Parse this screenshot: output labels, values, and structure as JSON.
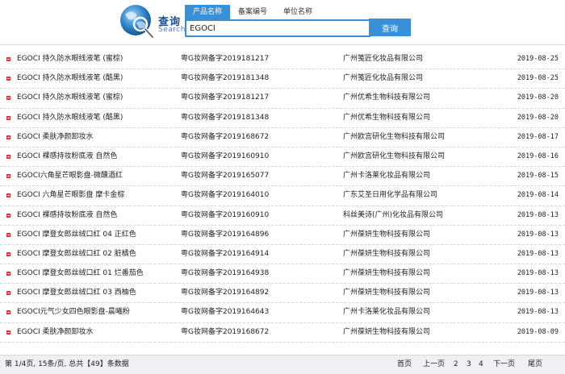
{
  "logo": {
    "title": "查询",
    "subtitle": "Search"
  },
  "tabs": [
    "产品名称",
    "备案编号",
    "单位名称"
  ],
  "search": {
    "value": "EGOCI",
    "button_label": "查询"
  },
  "rows": [
    {
      "name": "EGOCI 持久防水眼线液笔 (蜜棕)",
      "reg": "粤G妆网备字2019181217",
      "company": "广州笺匠化妆品有限公司",
      "date": "2019-08-25"
    },
    {
      "name": "EGOCI 持久防水眼线液笔 (酷黑)",
      "reg": "粤G妆网备字2019181348",
      "company": "广州笺匠化妆品有限公司",
      "date": "2019-08-25"
    },
    {
      "name": "EGOCI 持久防水眼线液笔 (蜜棕)",
      "reg": "粤G妆网备字2019181217",
      "company": "广州优希生物科技有限公司",
      "date": "2019-08-20"
    },
    {
      "name": "EGOCI 持久防水眼线液笔 (酷黑)",
      "reg": "粤G妆网备字2019181348",
      "company": "广州优希生物科技有限公司",
      "date": "2019-08-20"
    },
    {
      "name": "EGOCI 柔肤净颜卸妆水",
      "reg": "粤G妆网备字2019168672",
      "company": "广州欧宫研化生物科技有限公司",
      "date": "2019-08-17"
    },
    {
      "name": "EGOCI 裸感持妆粉底液 自然色",
      "reg": "粤G妆网备字2019160910",
      "company": "广州欧宫研化生物科技有限公司",
      "date": "2019-08-16"
    },
    {
      "name": "EGOCI六角星芒眼影盘-微醺酒红",
      "reg": "粤G妆网备字2019165077",
      "company": "广州卡洛莱化妆品有限公司",
      "date": "2019-08-15"
    },
    {
      "name": "EGOCI 六角星芒眼影盘 摩卡金棕",
      "reg": "粤G妆网备字2019164010",
      "company": "广东艾圣日用化学品有限公司",
      "date": "2019-08-14"
    },
    {
      "name": "EGOCI 裸感持妆粉底液 自然色",
      "reg": "粤G妆网备字2019160910",
      "company": "科丝美诗(广州)化妆品有限公司",
      "date": "2019-08-13"
    },
    {
      "name": "EGOCI 摩登女郎丝绒口红 04 正红色",
      "reg": "粤G妆网备字2019164896",
      "company": "广州葆妍生物科技有限公司",
      "date": "2019-08-13"
    },
    {
      "name": "EGOCI 摩登女郎丝绒口红 02 脏橘色",
      "reg": "粤G妆网备字2019164914",
      "company": "广州葆妍生物科技有限公司",
      "date": "2019-08-13"
    },
    {
      "name": "EGOCI 摩登女郎丝绒口红 01 烂番茄色",
      "reg": "粤G妆网备字2019164938",
      "company": "广州葆妍生物科技有限公司",
      "date": "2019-08-13"
    },
    {
      "name": "EGOCI 摩登女郎丝绒口红 03 西柚色",
      "reg": "粤G妆网备字2019164892",
      "company": "广州葆妍生物科技有限公司",
      "date": "2019-08-13"
    },
    {
      "name": "EGOCI元气少女四色眼影盘-晨曦粉",
      "reg": "粤G妆网备字2019164643",
      "company": "广州卡洛莱化妆品有限公司",
      "date": "2019-08-13"
    },
    {
      "name": "EGOCI 柔肤净颜卸妆水",
      "reg": "粤G妆网备字2019168672",
      "company": "广州葆妍生物科技有限公司",
      "date": "2019-08-09"
    }
  ],
  "footer": {
    "info": "第 1/4页, 15条/页, 总共【49】条数据",
    "first": "首页",
    "prev": "上一页",
    "pages": [
      "2",
      "3",
      "4"
    ],
    "next": "下一页",
    "last": "尾页"
  },
  "colors": {
    "accent": "#3a8fd9",
    "bullet": "#d9363e"
  }
}
